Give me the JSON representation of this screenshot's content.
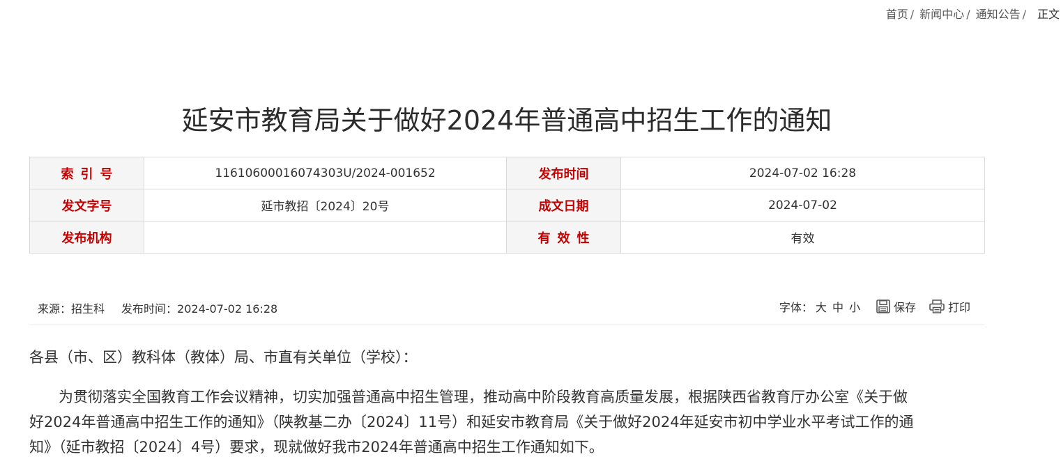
{
  "breadcrumb": {
    "items": [
      "首页",
      "新闻中心",
      "通知公告"
    ],
    "separator": "/",
    "current": "正文"
  },
  "article": {
    "title": "延安市教育局关于做好2024年普通高中招生工作的通知"
  },
  "meta_table": {
    "index_label": "索引号",
    "index_value": "11610600016074303U/2024-001652",
    "publish_time_label": "发布时间",
    "publish_time_value": "2024-07-02 16:28",
    "doc_number_label": "发文字号",
    "doc_number_value": "延市教招〔2024〕20号",
    "written_date_label": "成文日期",
    "written_date_value": "2024-07-02",
    "issuer_label": "发布机构",
    "issuer_value": "",
    "validity_label": "有效性",
    "validity_value": "有效"
  },
  "info_bar": {
    "source_label": "来源：",
    "source_value": "招生科",
    "time_label": "发布时间：",
    "time_value": "2024-07-02 16:28",
    "font_label": "字体：",
    "font_large": "大",
    "font_medium": "中",
    "font_small": "小",
    "save_label": "保存",
    "print_label": "打印"
  },
  "content": {
    "salutation": "各县（市、区）教科体（教体）局、市直有关单位（学校）：",
    "para_lines": [
      "为贯彻落实全国教育工作会议精神，切实加强普通高中招生管理，推动高中阶段教育高质量发展，根据陕西省教育厅办公室《关于做",
      "好2024年普通高中招生工作的通知》（陕教基二办〔2024〕11号）和延安市教育局《关于做好2024年延安市初中学业水平考试工作的通",
      "知》（延市教招〔2024〕4号）要求，现就做好我市2024年普通高中招生工作通知如下。"
    ]
  },
  "colors": {
    "label_red": "#c40000",
    "label_bg": "#f5f5f5",
    "border": "#d9d9d9"
  }
}
